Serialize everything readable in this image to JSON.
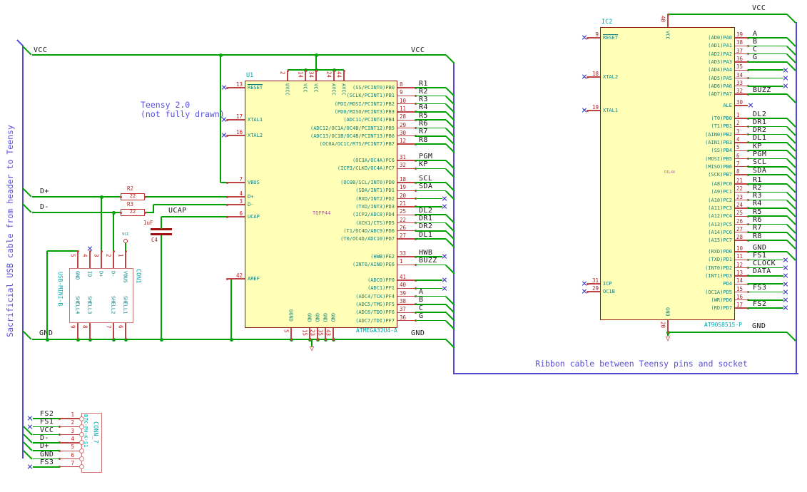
{
  "notes": {
    "left_cable": "Sacrificial USB cable from header to Teensy",
    "teensy_line1": "Teensy 2.0",
    "teensy_line2": "(not fully drawn)",
    "ribbon": "Ribbon cable between Teensy pins and socket"
  },
  "labels": {
    "vcc_left": "VCC",
    "vcc_right": "VCC",
    "gnd_left": "GND",
    "gnd_right": "GND",
    "d_plus": "D+",
    "d_minus": "D-",
    "ucap": "UCAP",
    "ic2_vcc": "VCC",
    "ic2_gnd": "GND",
    "vcc_symbol": "VCC"
  },
  "colors": {
    "wire": "#00a000",
    "pin": "#bc4444",
    "chip_fill": "#ffffb8",
    "chip_border": "#8c1a12",
    "cable_blue": "#5348d4",
    "no_connect": "#2d2dc8",
    "pin_name": "#0f8181",
    "pin_number": "#c01818",
    "reference": "#00a8a8",
    "footprint": "#c052c0",
    "connector_border": "#cf7777"
  },
  "u1": {
    "ref": "U1",
    "footprint": "TQFP44",
    "part": "ATMEGA32U4-A",
    "left_pins": [
      {
        "num": "13",
        "name": "RESET",
        "bar": true,
        "nc": true
      },
      {
        "num": "17",
        "name": "XTAL1",
        "nc": true
      },
      {
        "num": "16",
        "name": "XTAL2",
        "nc": true
      },
      {
        "num": "7",
        "name": "VBUS"
      },
      {
        "num": "4",
        "name": "D+"
      },
      {
        "num": "3",
        "name": "D-"
      },
      {
        "num": "6",
        "name": "UCAP"
      },
      {
        "num": "42",
        "name": "AREF"
      }
    ],
    "top_pins": [
      {
        "num": "2",
        "name": "UVCC"
      },
      {
        "num": "14",
        "name": "VCC"
      },
      {
        "num": "34",
        "name": "VCC"
      },
      {
        "num": "24",
        "name": "AVCC"
      },
      {
        "num": "44",
        "name": "AVCC"
      }
    ],
    "bottom_pins": [
      {
        "num": "5",
        "name": "UGND"
      },
      {
        "num": "15",
        "name": "GND"
      },
      {
        "num": "23",
        "name": "GND"
      },
      {
        "num": "35",
        "name": "GND"
      },
      {
        "num": "43",
        "name": "GND"
      }
    ],
    "right_groups": [
      {
        "pins": [
          {
            "num": "8",
            "name": "(SS/PCINT0)PB0",
            "label": "R1",
            "end": "cable"
          },
          {
            "num": "9",
            "name": "(SCLK/PCINT1)PB1",
            "label": "R2",
            "end": "cable"
          },
          {
            "num": "10",
            "name": "(PDI/MOSI/PCINT2)PB2",
            "label": "R3",
            "end": "cable"
          },
          {
            "num": "11",
            "name": "(PDO/MISO/PCINT3)PB3",
            "label": "R4",
            "end": "cable"
          },
          {
            "num": "28",
            "name": "(ADC11/PCINT4)PB4",
            "label": "R5",
            "end": "cable"
          },
          {
            "num": "29",
            "name": "(ADC12/OC1A/OC4B/PCINT12)PB5",
            "label": "R6",
            "end": "cable"
          },
          {
            "num": "30",
            "name": "(ADC13/OC1B/OC4B/PCINT13)PB6",
            "label": "R7",
            "end": "cable"
          },
          {
            "num": "12",
            "name": "(OC0A/OC1C/RTS/PCINT7)PB7",
            "label": "R8",
            "end": "cable"
          }
        ]
      },
      {
        "pins": [
          {
            "num": "31",
            "name": "(OC3A/OC4A)PC6",
            "label": "PGM",
            "end": "cable"
          },
          {
            "num": "32",
            "name": "(ICP3/CLKO/OC4A)PC7",
            "label": "KP",
            "end": "cable"
          }
        ]
      },
      {
        "pins": [
          {
            "num": "18",
            "name": "(OC0B/SCL/INT0)PD0",
            "label": "SCL",
            "end": "cable"
          },
          {
            "num": "19",
            "name": "(SDA/INT1)PD1",
            "label": "SDA",
            "end": "cable"
          },
          {
            "num": "20",
            "name": "(RXD/INT2)PD2",
            "label": "",
            "end": "nc"
          },
          {
            "num": "21",
            "name": "(TXD/INT3)PD3",
            "label": "",
            "end": "nc"
          },
          {
            "num": "25",
            "name": "(ICP2/ADC8)PD4",
            "label": "DL2",
            "end": "cable"
          },
          {
            "num": "22",
            "name": "(XCK1/CTS)PD5",
            "label": "DR1",
            "end": "cable"
          },
          {
            "num": "26",
            "name": "(T1/OC4D/ADC9)PD6",
            "label": "DR2",
            "end": "cable"
          },
          {
            "num": "27",
            "name": "(T0/OC4D/ADC10)PD7",
            "label": "DL1",
            "end": "cable"
          }
        ]
      },
      {
        "pins": [
          {
            "num": "33",
            "name": "(HWB)PE2",
            "label": "HWB",
            "end": "nc"
          },
          {
            "num": "1",
            "name": "(INT6/AIN0)PE6",
            "label": "BUZZ",
            "end": "cable"
          }
        ]
      },
      {
        "pins": [
          {
            "num": "41",
            "name": "(ADC0)PF0",
            "label": "",
            "end": "nc"
          },
          {
            "num": "40",
            "name": "(ADC1)PF1",
            "label": "",
            "end": "nc"
          },
          {
            "num": "39",
            "name": "(ADC4/TCK)PF4",
            "label": "A",
            "end": "cable"
          },
          {
            "num": "38",
            "name": "(ADC5/TMS)PF5",
            "label": "B",
            "end": "cable"
          },
          {
            "num": "37",
            "name": "(ADC6/TDO)PF6",
            "label": "C",
            "end": "cable"
          },
          {
            "num": "36",
            "name": "(ADC7/TDI)PF7",
            "label": "G",
            "end": "cable"
          }
        ]
      }
    ]
  },
  "ic2": {
    "ref": "IC2",
    "footprint": "DIL40",
    "part": "AT90S8515-P",
    "left_pins": [
      {
        "num": "9",
        "name": "RESET",
        "bar": true,
        "nc": true
      },
      {
        "num": "18",
        "name": "XTAL2",
        "nc": true
      },
      {
        "num": "19",
        "name": "XTAL1",
        "nc": true
      },
      {
        "num": "31",
        "name": "ICP",
        "nc": true
      },
      {
        "num": "29",
        "name": "OC1B",
        "nc": true
      }
    ],
    "top_pins": [
      {
        "num": "40",
        "name": "VCC"
      }
    ],
    "bottom_pins": [
      {
        "num": "20",
        "name": "GND"
      }
    ],
    "right_groups": [
      {
        "pins": [
          {
            "num": "39",
            "name": "(AD0)PA0",
            "label": "A",
            "end": "cable"
          },
          {
            "num": "38",
            "name": "(AD1)PA1",
            "label": "B",
            "end": "cable"
          },
          {
            "num": "37",
            "name": "(AD2)PA2",
            "label": "C",
            "end": "cable"
          },
          {
            "num": "36",
            "name": "(AD3)PA3",
            "label": "G",
            "end": "cable"
          },
          {
            "num": "35",
            "name": "(AD4)PA4",
            "label": "",
            "end": "nc"
          },
          {
            "num": "34",
            "name": "(AD5)PA5",
            "label": "",
            "end": "nc"
          },
          {
            "num": "33",
            "name": "(AD6)PA6",
            "label": "",
            "end": "nc"
          },
          {
            "num": "32",
            "name": "(AD7)PA7",
            "label": "BUZZ",
            "end": "cable"
          }
        ]
      },
      {
        "pins": [
          {
            "num": "30",
            "name": "ALE",
            "label": "",
            "end": "ncshort"
          }
        ]
      },
      {
        "pins": [
          {
            "num": "1",
            "name": "(T0)PB0",
            "label": "DL2",
            "end": "cable"
          },
          {
            "num": "2",
            "name": "(T1)PB1",
            "label": "DR1",
            "end": "cable"
          },
          {
            "num": "3",
            "name": "(AIN0)PB2",
            "label": "DR2",
            "end": "cable"
          },
          {
            "num": "4",
            "name": "(AIN1)PB3",
            "label": "DL1",
            "end": "cable"
          },
          {
            "num": "5",
            "name": "(SS)PB4",
            "label": "KP",
            "end": "cable"
          },
          {
            "num": "6",
            "name": "(MOSI)PB5",
            "label": "PGM",
            "end": "cable"
          },
          {
            "num": "7",
            "name": "(MISO)PB6",
            "label": "SCL",
            "end": "cable"
          },
          {
            "num": "8",
            "name": "(SCK)PB7",
            "label": "SDA",
            "end": "cable"
          }
        ]
      },
      {
        "pins": [
          {
            "num": "21",
            "name": "(A8)PC0",
            "label": "R1",
            "end": "cable"
          },
          {
            "num": "22",
            "name": "(A9)PC1",
            "label": "R2",
            "end": "cable"
          },
          {
            "num": "23",
            "name": "(A10)PC2",
            "label": "R3",
            "end": "cable"
          },
          {
            "num": "24",
            "name": "(A11)PC3",
            "label": "R4",
            "end": "cable"
          },
          {
            "num": "25",
            "name": "(A12)PC4",
            "label": "R5",
            "end": "cable"
          },
          {
            "num": "26",
            "name": "(A13)PC5",
            "label": "R6",
            "end": "cable"
          },
          {
            "num": "27",
            "name": "(A14)PC6",
            "label": "R7",
            "end": "cable"
          },
          {
            "num": "28",
            "name": "(A15)PC7",
            "label": "R8",
            "end": "cable"
          }
        ]
      },
      {
        "pins": [
          {
            "num": "10",
            "name": "(RXD)PD0",
            "label": "GND",
            "end": "cable"
          },
          {
            "num": "11",
            "name": "(TXD)PD1",
            "label": "FS1",
            "end": "nc"
          },
          {
            "num": "12",
            "name": "(INT0)PD2",
            "label": "CLOCK",
            "end": "nc"
          },
          {
            "num": "13",
            "name": "(INT1)PD3",
            "label": "DATA",
            "end": "nc"
          },
          {
            "num": "14",
            "name": "PD4",
            "label": "",
            "end": "nc"
          },
          {
            "num": "15",
            "name": "(OC1A)PD5",
            "label": "FS3",
            "end": "nc"
          },
          {
            "num": "16",
            "name": "(WR)PD6",
            "label": "",
            "end": "nc"
          },
          {
            "num": "17",
            "name": "(RD)PD7",
            "label": "FS2",
            "end": "nc"
          }
        ]
      }
    ]
  },
  "con1": {
    "ref": "CON1",
    "part": "USB-MINI-B",
    "top_pins": [
      {
        "num": "5",
        "name": "GND"
      },
      {
        "num": "4",
        "name": "ID",
        "nc": true
      },
      {
        "num": "3",
        "name": "D+"
      },
      {
        "num": "2",
        "name": "D-"
      },
      {
        "num": "1",
        "name": "VBUS"
      }
    ],
    "bottom_pins": [
      {
        "num": "9",
        "name": "SHELL4"
      },
      {
        "num": "8",
        "name": "SHELL3"
      },
      {
        "num": "7",
        "name": "SHELL2"
      },
      {
        "num": "6",
        "name": "SHELL1"
      }
    ]
  },
  "conn7": {
    "ref": "CONN_7",
    "part": "B7K-PH-K-S1",
    "pins": [
      {
        "num": "1",
        "label": "FS2",
        "nc": true
      },
      {
        "num": "2",
        "label": "FS1",
        "nc": true
      },
      {
        "num": "3",
        "label": "VCC"
      },
      {
        "num": "4",
        "label": "D-"
      },
      {
        "num": "5",
        "label": "D+"
      },
      {
        "num": "6",
        "label": "GND"
      },
      {
        "num": "7",
        "label": "FS3",
        "nc": true
      }
    ]
  },
  "r2": {
    "ref": "R2",
    "value": "22"
  },
  "r3": {
    "ref": "R3",
    "value": "22"
  },
  "c4": {
    "ref": "C4",
    "value": "1uF"
  }
}
